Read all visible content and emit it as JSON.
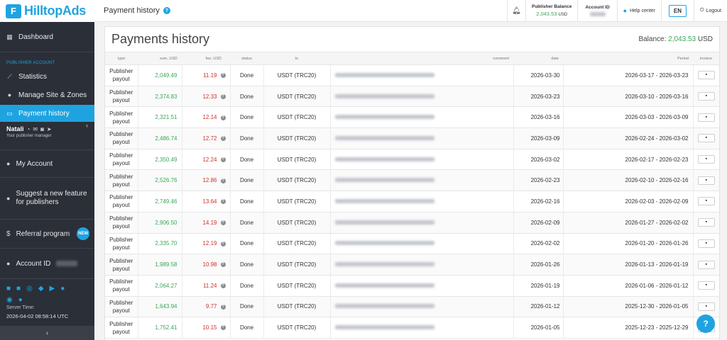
{
  "brand": {
    "logo_letter": "F",
    "name": "HilltopAds"
  },
  "sidebar": {
    "dashboard": "Dashboard",
    "section_label": "PUBLISHER ACCOUNT",
    "statistics": "Statistics",
    "manage_sites": "Manage Site & Zones",
    "payment_history": "Payment history",
    "manager_name": "Natali",
    "manager_sub": "Your publisher manager",
    "my_account": "My Account",
    "suggest_line1": "Suggest a new feature",
    "suggest_line2": "for publishers",
    "referral": "Referral program",
    "new_badge": "NEW",
    "account_id_label": "Account ID",
    "server_time_label": "Server Time:",
    "server_time": "2026-04-02 08:58:14 UTC"
  },
  "topbar": {
    "title": "Payment history",
    "publisher_balance_label": "Publisher Balance",
    "publisher_balance_value": "2,043.53",
    "publisher_balance_currency": "USD",
    "account_id_label": "Account ID",
    "help_center": "Help center",
    "language": "EN",
    "logout": "Logout"
  },
  "main": {
    "title": "Payments history",
    "balance_label": "Balance:",
    "balance_value": "2,043.53",
    "balance_currency": "USD",
    "columns": {
      "type": "type",
      "sum": "sum, USD",
      "fee": "fee, USD",
      "status": "status",
      "to": "to",
      "comment": "comment",
      "date": "date",
      "period": "Period",
      "invoice": "invoice"
    },
    "rows": [
      {
        "type1": "Publisher",
        "type2": "payout",
        "sum": "2,049.49",
        "fee": "11.19",
        "status": "Done",
        "to": "USDT (TRC20)",
        "date": "2026-03-30",
        "period": "2026-03-17 - 2026-03-23"
      },
      {
        "type1": "Publisher",
        "type2": "payout",
        "sum": "2,374.83",
        "fee": "12.33",
        "status": "Done",
        "to": "USDT (TRC20)",
        "date": "2026-03-23",
        "period": "2026-03-10 - 2026-03-16"
      },
      {
        "type1": "Publisher",
        "type2": "payout",
        "sum": "2,321.51",
        "fee": "12.14",
        "status": "Done",
        "to": "USDT (TRC20)",
        "date": "2026-03-16",
        "period": "2026-03-03 - 2026-03-09"
      },
      {
        "type1": "Publisher",
        "type2": "payout",
        "sum": "2,486.74",
        "fee": "12.72",
        "status": "Done",
        "to": "USDT (TRC20)",
        "date": "2026-03-09",
        "period": "2026-02-24 - 2026-03-02"
      },
      {
        "type1": "Publisher",
        "type2": "payout",
        "sum": "2,350.49",
        "fee": "12.24",
        "status": "Done",
        "to": "USDT (TRC20)",
        "date": "2026-03-02",
        "period": "2026-02-17 - 2026-02-23"
      },
      {
        "type1": "Publisher",
        "type2": "payout",
        "sum": "2,526.76",
        "fee": "12.86",
        "status": "Done",
        "to": "USDT (TRC20)",
        "date": "2026-02-23",
        "period": "2026-02-10 - 2026-02-16"
      },
      {
        "type1": "Publisher",
        "type2": "payout",
        "sum": "2,749.46",
        "fee": "13.64",
        "status": "Done",
        "to": "USDT (TRC20)",
        "date": "2026-02-16",
        "period": "2026-02-03 - 2026-02-09"
      },
      {
        "type1": "Publisher",
        "type2": "payout",
        "sum": "2,906.50",
        "fee": "14.19",
        "status": "Done",
        "to": "USDT (TRC20)",
        "date": "2026-02-09",
        "period": "2026-01-27 - 2026-02-02"
      },
      {
        "type1": "Publisher",
        "type2": "payout",
        "sum": "2,335.70",
        "fee": "12.19",
        "status": "Done",
        "to": "USDT (TRC20)",
        "date": "2026-02-02",
        "period": "2026-01-20 - 2026-01-26"
      },
      {
        "type1": "Publisher",
        "type2": "payout",
        "sum": "1,989.58",
        "fee": "10.98",
        "status": "Done",
        "to": "USDT (TRC20)",
        "date": "2026-01-26",
        "period": "2026-01-13 - 2026-01-19"
      },
      {
        "type1": "Publisher",
        "type2": "payout",
        "sum": "2,064.27",
        "fee": "11.24",
        "status": "Done",
        "to": "USDT (TRC20)",
        "date": "2026-01-19",
        "period": "2026-01-06 - 2026-01-12"
      },
      {
        "type1": "Publisher",
        "type2": "payout",
        "sum": "1,643.94",
        "fee": "9.77",
        "status": "Done",
        "to": "USDT (TRC20)",
        "date": "2026-01-12",
        "period": "2025-12-30 - 2026-01-05"
      },
      {
        "type1": "Publisher",
        "type2": "payout",
        "sum": "1,752.41",
        "fee": "10.15",
        "status": "Done",
        "to": "USDT (TRC20)",
        "date": "2026-01-05",
        "period": "2025-12-23 - 2025-12-29"
      }
    ]
  },
  "colors": {
    "accent": "#1fa3e0",
    "sidebar_bg": "#2b2f38",
    "positive": "#3aa757",
    "negative": "#d0312d"
  }
}
